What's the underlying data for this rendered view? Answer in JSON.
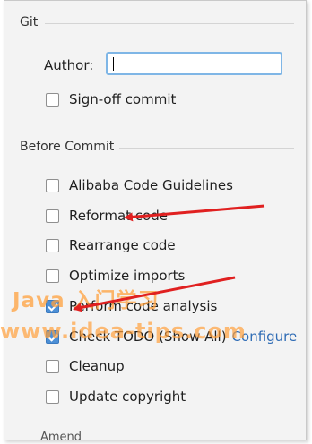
{
  "git_section": {
    "title": "Git",
    "author_label": "Author:",
    "author_value": "",
    "signoff_label": "Sign-off commit",
    "signoff_checked": false
  },
  "before_commit": {
    "title": "Before Commit",
    "options": [
      {
        "label": "Alibaba Code Guidelines",
        "checked": false
      },
      {
        "label": "Reformat code",
        "checked": false
      },
      {
        "label": "Rearrange code",
        "checked": false
      },
      {
        "label": "Optimize imports",
        "checked": false
      },
      {
        "label": "Perform code analysis",
        "checked": true
      },
      {
        "label": "Check TODO (Show All)",
        "checked": true,
        "link": "Configure"
      },
      {
        "label": "Cleanup",
        "checked": false
      },
      {
        "label": "Update copyright",
        "checked": false
      }
    ]
  },
  "amend": {
    "label": "Amend"
  },
  "watermark": {
    "line1": "Java 入门学习",
    "line2": "www.idea-tips.com"
  },
  "colors": {
    "arrow": "#e02020",
    "accent": "#4c8fd6",
    "link": "#2f6cb5"
  }
}
